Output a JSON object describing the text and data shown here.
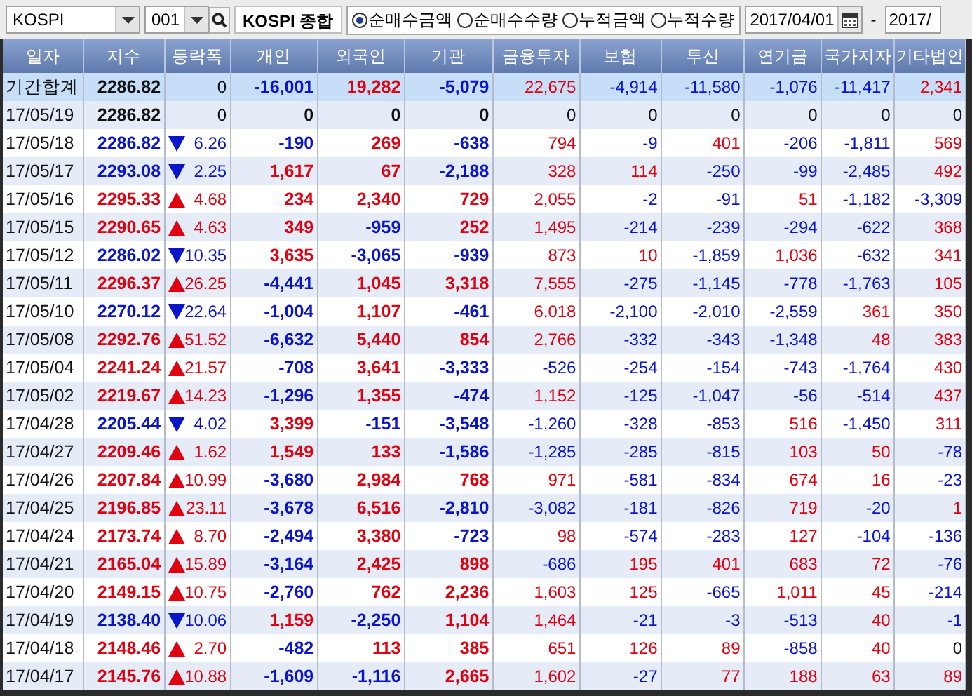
{
  "toolbar": {
    "market": {
      "value": "KOSPI"
    },
    "code": {
      "value": "001"
    },
    "index_name": "KOSPI 종합",
    "modes": [
      {
        "label": "순매수금액",
        "selected": true
      },
      {
        "label": "순매수수량",
        "selected": false
      },
      {
        "label": "누적금액",
        "selected": false
      },
      {
        "label": "누적수량",
        "selected": false
      }
    ],
    "date_from": {
      "value": "2017/04/01"
    },
    "date_separator": "-",
    "date_to": {
      "value": "2017/"
    }
  },
  "table": {
    "columns": [
      "일자",
      "지수",
      "등락폭",
      "개인",
      "외국인",
      "기관",
      "금융투자",
      "보험",
      "투신",
      "연기금",
      "국가지자",
      "기타법인"
    ],
    "rows": [
      {
        "kind": "total",
        "date": "기간합계",
        "index": "2286.82",
        "up": false,
        "down": false,
        "change": "0",
        "values": [
          "-16,001",
          "19,282",
          "-5,079",
          "22,675",
          "-4,914",
          "-11,580",
          "-1,076",
          "-11,417",
          "2,341"
        ]
      },
      {
        "kind": "day",
        "date": "17/05/19",
        "index": "2286.82",
        "up": false,
        "down": false,
        "change": "0",
        "values": [
          "0",
          "0",
          "0",
          "0",
          "0",
          "0",
          "0",
          "0",
          "0"
        ]
      },
      {
        "kind": "day",
        "date": "17/05/18",
        "index": "2286.82",
        "up": false,
        "down": true,
        "change": "6.26",
        "values": [
          "-190",
          "269",
          "-638",
          "794",
          "-9",
          "401",
          "-206",
          "-1,811",
          "569"
        ]
      },
      {
        "kind": "day",
        "date": "17/05/17",
        "index": "2293.08",
        "up": false,
        "down": true,
        "change": "2.25",
        "values": [
          "1,617",
          "67",
          "-2,188",
          "328",
          "114",
          "-250",
          "-99",
          "-2,485",
          "492"
        ]
      },
      {
        "kind": "day",
        "date": "17/05/16",
        "index": "2295.33",
        "up": true,
        "down": false,
        "change": "4.68",
        "values": [
          "234",
          "2,340",
          "729",
          "2,055",
          "-2",
          "-91",
          "51",
          "-1,182",
          "-3,309"
        ]
      },
      {
        "kind": "day",
        "date": "17/05/15",
        "index": "2290.65",
        "up": true,
        "down": false,
        "change": "4.63",
        "values": [
          "349",
          "-959",
          "252",
          "1,495",
          "-214",
          "-239",
          "-294",
          "-622",
          "368"
        ]
      },
      {
        "kind": "day",
        "date": "17/05/12",
        "index": "2286.02",
        "up": false,
        "down": true,
        "change": "10.35",
        "values": [
          "3,635",
          "-3,065",
          "-939",
          "873",
          "10",
          "-1,859",
          "1,036",
          "-632",
          "341"
        ]
      },
      {
        "kind": "day",
        "date": "17/05/11",
        "index": "2296.37",
        "up": true,
        "down": false,
        "change": "26.25",
        "values": [
          "-4,441",
          "1,045",
          "3,318",
          "7,555",
          "-275",
          "-1,145",
          "-778",
          "-1,763",
          "105"
        ]
      },
      {
        "kind": "day",
        "date": "17/05/10",
        "index": "2270.12",
        "up": false,
        "down": true,
        "change": "22.64",
        "values": [
          "-1,004",
          "1,107",
          "-461",
          "6,018",
          "-2,100",
          "-2,010",
          "-2,559",
          "361",
          "350"
        ]
      },
      {
        "kind": "day",
        "date": "17/05/08",
        "index": "2292.76",
        "up": true,
        "down": false,
        "change": "51.52",
        "values": [
          "-6,632",
          "5,440",
          "854",
          "2,766",
          "-332",
          "-343",
          "-1,348",
          "48",
          "383"
        ]
      },
      {
        "kind": "day",
        "date": "17/05/04",
        "index": "2241.24",
        "up": true,
        "down": false,
        "change": "21.57",
        "values": [
          "-708",
          "3,641",
          "-3,333",
          "-526",
          "-254",
          "-154",
          "-743",
          "-1,764",
          "430"
        ]
      },
      {
        "kind": "day",
        "date": "17/05/02",
        "index": "2219.67",
        "up": true,
        "down": false,
        "change": "14.23",
        "values": [
          "-1,296",
          "1,355",
          "-474",
          "1,152",
          "-125",
          "-1,047",
          "-56",
          "-514",
          "437"
        ]
      },
      {
        "kind": "day",
        "date": "17/04/28",
        "index": "2205.44",
        "up": false,
        "down": true,
        "change": "4.02",
        "values": [
          "3,399",
          "-151",
          "-3,548",
          "-1,260",
          "-328",
          "-853",
          "516",
          "-1,450",
          "311"
        ]
      },
      {
        "kind": "day",
        "date": "17/04/27",
        "index": "2209.46",
        "up": true,
        "down": false,
        "change": "1.62",
        "values": [
          "1,549",
          "133",
          "-1,586",
          "-1,285",
          "-285",
          "-815",
          "103",
          "50",
          "-78"
        ]
      },
      {
        "kind": "day",
        "date": "17/04/26",
        "index": "2207.84",
        "up": true,
        "down": false,
        "change": "10.99",
        "values": [
          "-3,680",
          "2,984",
          "768",
          "971",
          "-581",
          "-834",
          "674",
          "16",
          "-23"
        ]
      },
      {
        "kind": "day",
        "date": "17/04/25",
        "index": "2196.85",
        "up": true,
        "down": false,
        "change": "23.11",
        "values": [
          "-3,678",
          "6,516",
          "-2,810",
          "-3,082",
          "-181",
          "-826",
          "719",
          "-20",
          "1"
        ]
      },
      {
        "kind": "day",
        "date": "17/04/24",
        "index": "2173.74",
        "up": true,
        "down": false,
        "change": "8.70",
        "values": [
          "-2,494",
          "3,380",
          "-723",
          "98",
          "-574",
          "-283",
          "127",
          "-104",
          "-136"
        ]
      },
      {
        "kind": "day",
        "date": "17/04/21",
        "index": "2165.04",
        "up": true,
        "down": false,
        "change": "15.89",
        "values": [
          "-3,164",
          "2,425",
          "898",
          "-686",
          "195",
          "401",
          "683",
          "72",
          "-76"
        ]
      },
      {
        "kind": "day",
        "date": "17/04/20",
        "index": "2149.15",
        "up": true,
        "down": false,
        "change": "10.75",
        "values": [
          "-2,760",
          "762",
          "2,236",
          "1,603",
          "125",
          "-665",
          "1,011",
          "45",
          "-214"
        ]
      },
      {
        "kind": "day",
        "date": "17/04/19",
        "index": "2138.40",
        "up": false,
        "down": true,
        "change": "10.06",
        "values": [
          "1,159",
          "-2,250",
          "1,104",
          "1,464",
          "-21",
          "-3",
          "-513",
          "40",
          "-1"
        ]
      },
      {
        "kind": "day",
        "date": "17/04/18",
        "index": "2148.46",
        "up": true,
        "down": false,
        "change": "2.70",
        "values": [
          "-482",
          "113",
          "385",
          "651",
          "126",
          "89",
          "-858",
          "40",
          "0"
        ]
      },
      {
        "kind": "day",
        "date": "17/04/17",
        "index": "2145.76",
        "up": true,
        "down": false,
        "change": "10.88",
        "values": [
          "-1,609",
          "-1,116",
          "2,665",
          "1,602",
          "-27",
          "77",
          "188",
          "63",
          "89"
        ]
      }
    ]
  }
}
